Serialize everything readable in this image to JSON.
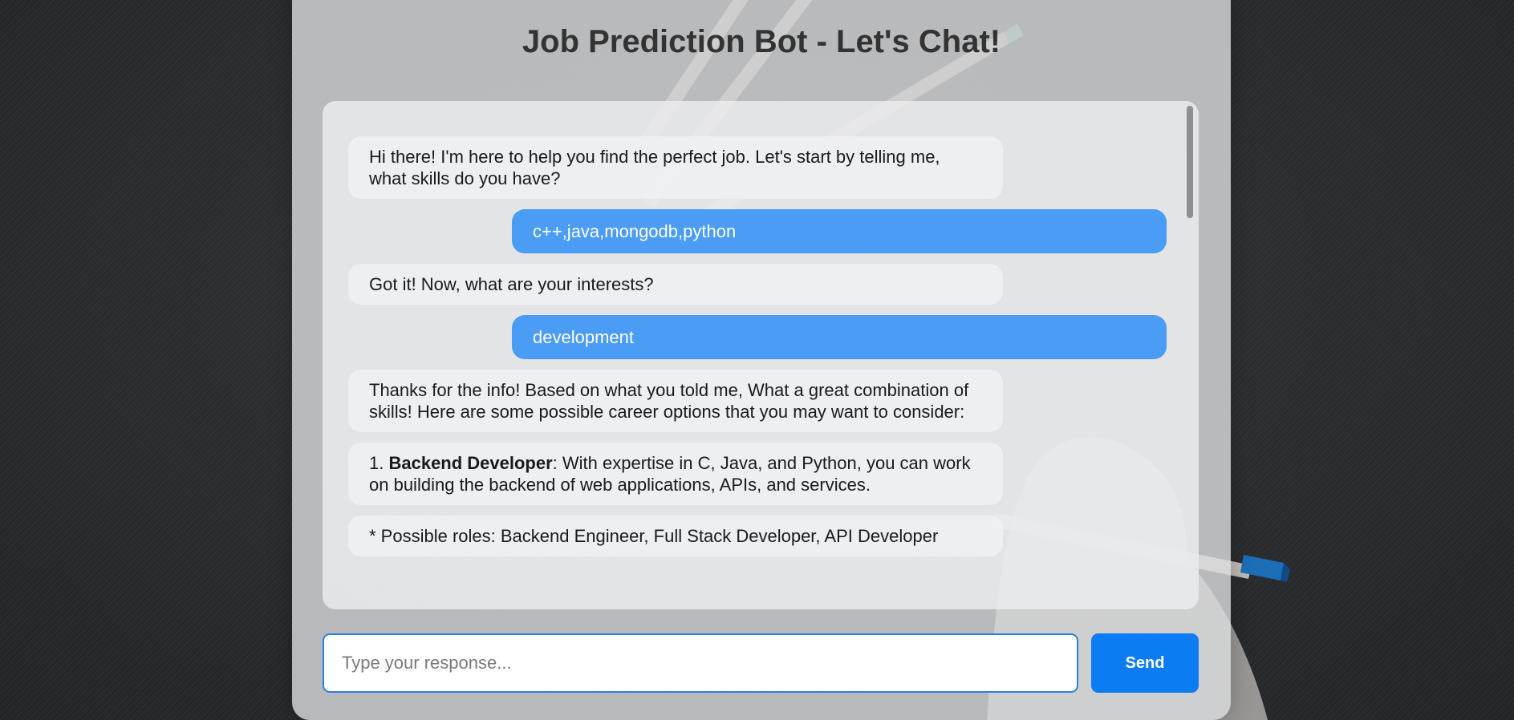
{
  "header": {
    "title": "Job Prediction Bot - Let's Chat!"
  },
  "chat": {
    "messages": [
      {
        "role": "bot",
        "text": "Hi there! I'm here to help you find the perfect job. Let's start by telling me, what skills do you have?"
      },
      {
        "role": "user",
        "text": "c++,java,mongodb,python"
      },
      {
        "role": "bot",
        "text": "Got it! Now, what are your interests?"
      },
      {
        "role": "user",
        "text": "development"
      },
      {
        "role": "bot",
        "text": "Thanks for the info! Based on what you told me, What a great combination of skills! Here are some possible career options that you may want to consider:"
      },
      {
        "role": "bot",
        "prefix": "1. ",
        "bold": "Backend Developer",
        "suffix": ": With expertise in C, Java, and Python, you can work on building the backend of web applications, APIs, and services."
      },
      {
        "role": "bot",
        "text": "* Possible roles: Backend Engineer, Full Stack Developer, API Developer"
      }
    ]
  },
  "input": {
    "placeholder": "Type your response...",
    "value": ""
  },
  "send_button": {
    "label": "Send"
  },
  "colors": {
    "user_bubble": "#4b9cf5",
    "send_button": "#0b7cf2",
    "input_border": "#2b7fe0"
  }
}
